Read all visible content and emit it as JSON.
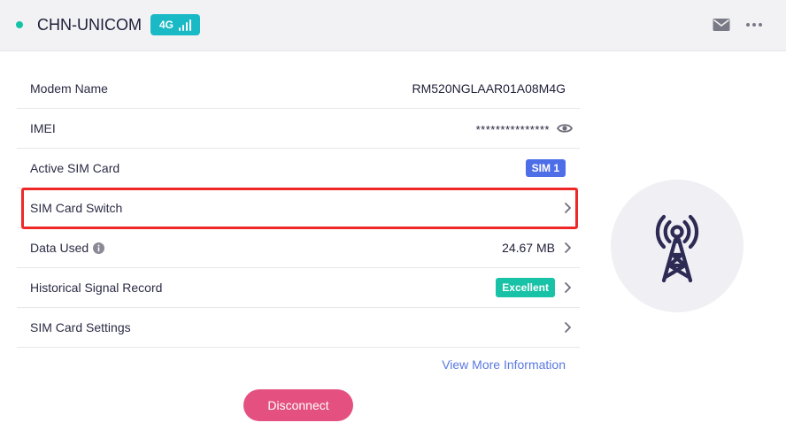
{
  "header": {
    "carrier": "CHN-UNICOM",
    "network_badge": "4G",
    "icons": {
      "status": "status-dot",
      "signal": "signal-bars-icon",
      "mail": "mail-icon",
      "more": "more-icon"
    }
  },
  "info": {
    "modem_name": {
      "label": "Modem Name",
      "value": "RM520NGLAAR01A08M4G"
    },
    "imei": {
      "label": "IMEI",
      "value": "***************"
    },
    "active_sim": {
      "label": "Active SIM Card",
      "value": "SIM 1"
    },
    "sim_switch": {
      "label": "SIM Card Switch"
    },
    "data_used": {
      "label": "Data Used",
      "value": "24.67 MB"
    },
    "signal_record": {
      "label": "Historical Signal Record",
      "value": "Excellent"
    },
    "sim_settings": {
      "label": "SIM Card Settings"
    }
  },
  "links": {
    "view_more": "View More Information"
  },
  "actions": {
    "disconnect": "Disconnect"
  },
  "colors": {
    "accent_teal": "#19b9c6",
    "excellent_green": "#17c2a6",
    "sim_blue": "#4e6ee8",
    "disconnect_pink": "#e4507f",
    "highlight_red": "#ee2727",
    "link_blue": "#5a78e0"
  }
}
